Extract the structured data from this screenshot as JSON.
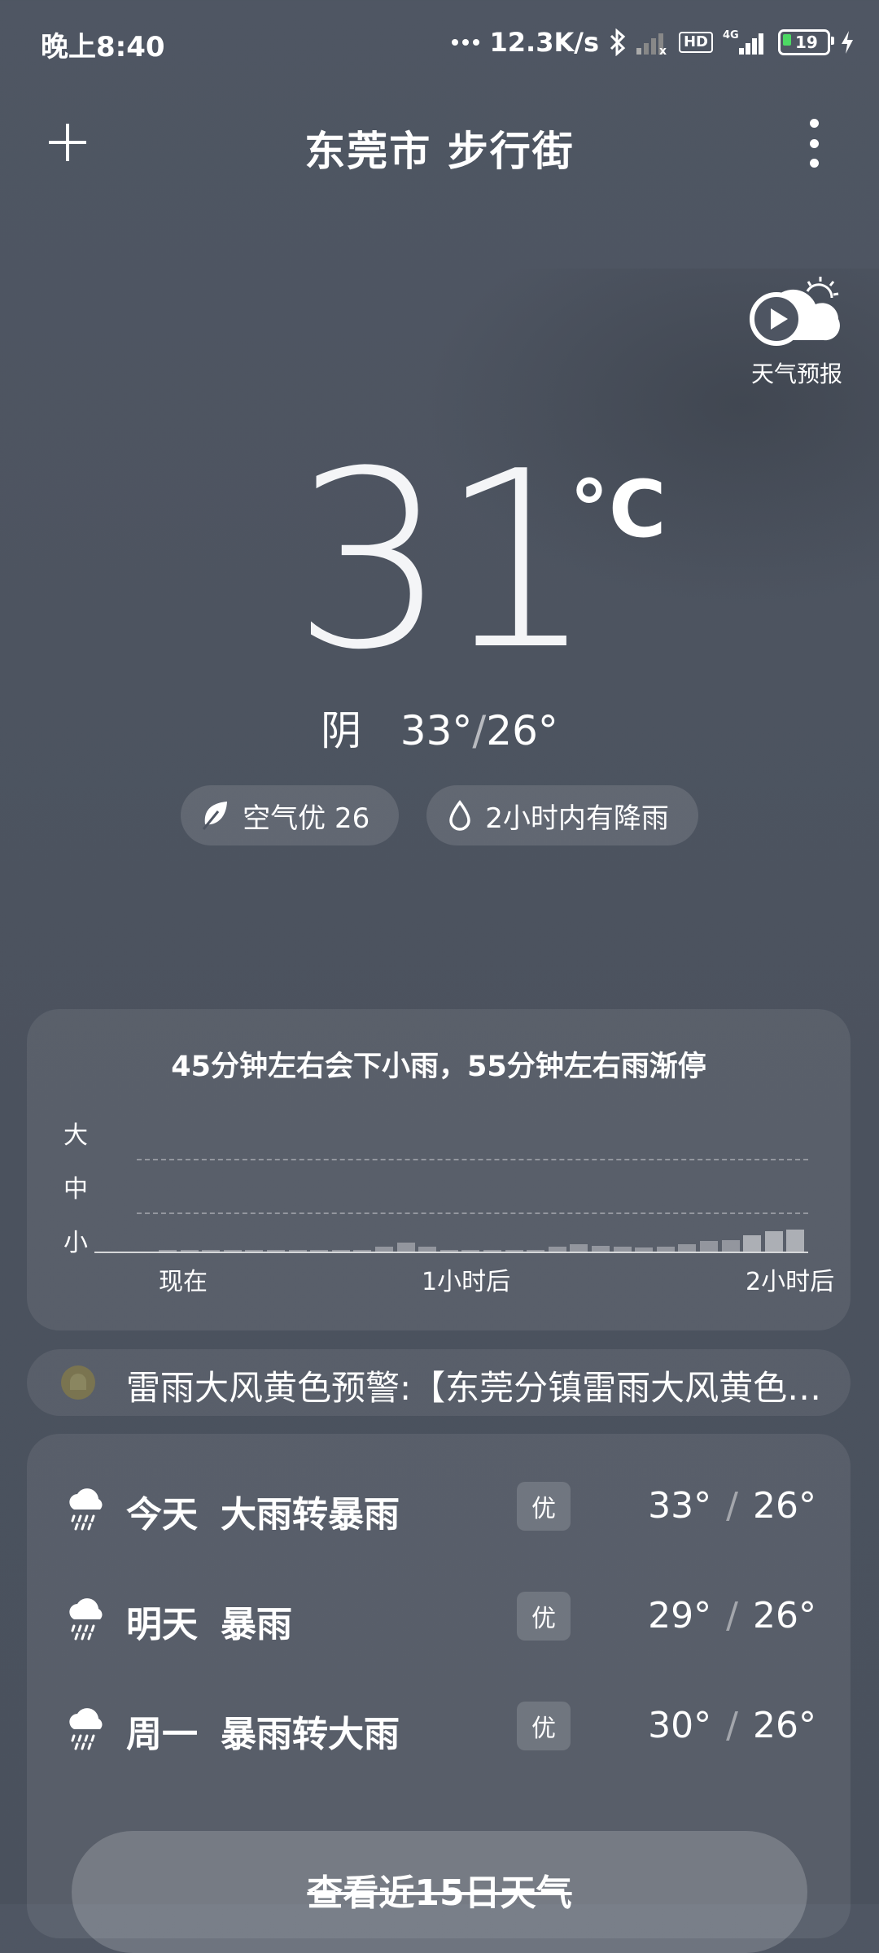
{
  "status_bar": {
    "time": "晚上8:40",
    "net_speed": "12.3K/s",
    "hd_label": "HD",
    "network_type": "4G",
    "battery_level": "19",
    "icons": [
      "more-dots-icon",
      "bluetooth-icon",
      "signal-weak-icon",
      "hd-icon",
      "signal-4g-icon",
      "battery-icon",
      "charging-icon"
    ]
  },
  "header": {
    "title": "东莞市 步行街",
    "add_icon": "plus-icon",
    "more_icon": "more-vertical-icon"
  },
  "video_forecast": {
    "label": "天气预报",
    "icon": "play-cloud-sun-icon"
  },
  "current": {
    "temperature": "31",
    "unit": "°C",
    "condition": "阴",
    "high": "33°",
    "low": "26°",
    "separator": "/"
  },
  "chips": [
    {
      "icon": "leaf-icon",
      "label": "空气优 26"
    },
    {
      "icon": "droplet-icon",
      "label": "2小时内有降雨"
    }
  ],
  "precip": {
    "summary": "45分钟左右会下小雨，55分钟左右雨渐停",
    "y_labels": [
      "大",
      "中",
      "小"
    ],
    "x_labels": [
      "现在",
      "1小时后",
      "2小时后"
    ],
    "intensity": [
      0.05,
      0.05,
      0.05,
      0.05,
      0.05,
      0.05,
      0.05,
      0.05,
      0.05,
      0.05,
      0.15,
      0.3,
      0.17,
      0.05,
      0.05,
      0.05,
      0.05,
      0.05,
      0.17,
      0.25,
      0.18,
      0.15,
      0.12,
      0.15,
      0.25,
      0.33,
      0.38,
      0.52,
      0.65,
      0.7
    ]
  },
  "warning": {
    "icon": "alert-bell-icon",
    "color": "#b8a84a",
    "text": "雷雨大风黄色预警:【东莞分镇雷雨大风黄色预警信号】"
  },
  "daily": [
    {
      "day": "今天",
      "desc": "大雨转暴雨",
      "aqi": "优",
      "high": "33°",
      "low": "26°",
      "icon": "heavy-rain-icon"
    },
    {
      "day": "明天",
      "desc": "暴雨",
      "aqi": "优",
      "high": "29°",
      "low": "26°",
      "icon": "heavy-rain-icon"
    },
    {
      "day": "周一",
      "desc": "暴雨转大雨",
      "aqi": "优",
      "high": "30°",
      "low": "26°",
      "icon": "heavy-rain-icon"
    }
  ],
  "temp_separator": "/",
  "more_days_label": "查看近15日天气"
}
